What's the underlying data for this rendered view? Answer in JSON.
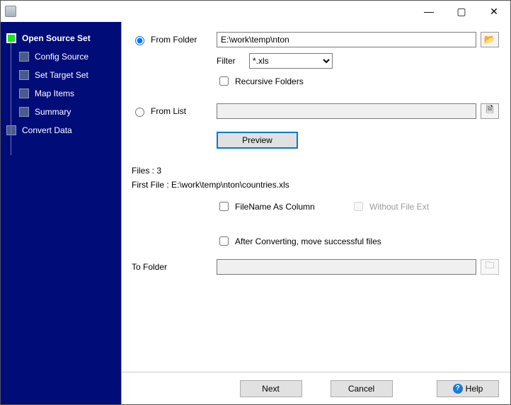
{
  "titlebar": {
    "title": ""
  },
  "sidebar": {
    "items": [
      {
        "label": "Open Source Set"
      },
      {
        "label": "Config Source"
      },
      {
        "label": "Set Target Set"
      },
      {
        "label": "Map Items"
      },
      {
        "label": "Summary"
      },
      {
        "label": "Convert Data"
      }
    ]
  },
  "main": {
    "from_folder_label": "From Folder",
    "from_folder_value": "E:\\work\\temp\\nton",
    "filter_label": "Filter",
    "filter_value": "*.xls",
    "recursive_label": "Recursive Folders",
    "from_list_label": "From List",
    "from_list_value": "",
    "preview_label": "Preview",
    "files_count_label": "Files : 3",
    "first_file_label": "First File : E:\\work\\temp\\nton\\countries.xls",
    "filename_as_column_label": "FileName As Column",
    "without_ext_label": "Without File Ext",
    "after_convert_label": "After Converting, move successful files",
    "to_folder_label": "To Folder",
    "to_folder_value": ""
  },
  "footer": {
    "next": "Next",
    "cancel": "Cancel",
    "help": "Help"
  }
}
